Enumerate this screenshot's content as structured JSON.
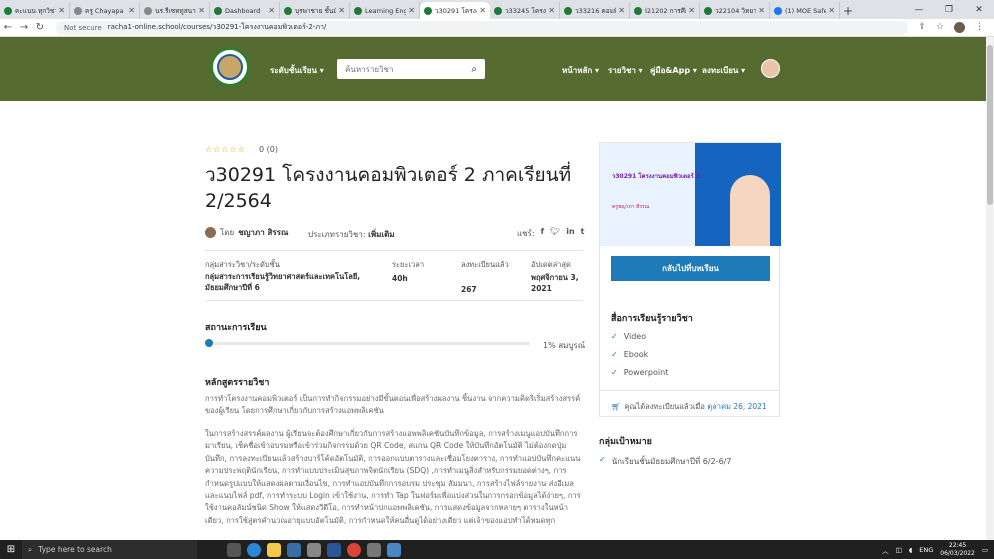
{
  "browser": {
    "tabs": [
      {
        "title": "คะแนน ทุกวิชา",
        "color": "#188038",
        "active": false
      },
      {
        "title": "ครู Chayapa",
        "color": "#888888",
        "active": false
      },
      {
        "title": "นร.รีเซททูสนาสรา",
        "color": "#888888",
        "active": false
      },
      {
        "title": "Dashboard",
        "color": "#1f7a3a",
        "active": false
      },
      {
        "title": "บุรพาชาย ชั้นมั",
        "color": "#1f7a3a",
        "active": false
      },
      {
        "title": "Learning Eng",
        "color": "#1f7a3a",
        "active": false
      },
      {
        "title": "ว30291 โครงง",
        "color": "#1f7a3a",
        "active": true
      },
      {
        "title": "ว33245 โครงง",
        "color": "#1f7a3a",
        "active": false
      },
      {
        "title": "ว33216 คอมพิ",
        "color": "#1f7a3a",
        "active": false
      },
      {
        "title": "I21202 การศึก",
        "color": "#1f7a3a",
        "active": false
      },
      {
        "title": "ว22104 วิทยาศ",
        "color": "#1f7a3a",
        "active": false
      },
      {
        "title": "(1) MOE Safe",
        "color": "#1877f2",
        "active": false
      }
    ],
    "new_tab": "+",
    "address": {
      "not_secure": "Not secure",
      "url": "racha1-online.school/courses/ว30291-โครงงานคอมพิวเตอร์-2-ภา/"
    }
  },
  "header": {
    "levels_label": "ระดับชั้นเรียน ▾",
    "search_placeholder": "ค้นหารายวิชา",
    "menu": [
      "หน้าหลัก ▾",
      "รายวิชา ▾",
      "คู่มือ&App ▾",
      "ลงทะเบียน ▾"
    ]
  },
  "course": {
    "stars": "☆☆☆☆☆",
    "rating": "0 (0)",
    "title": "ว30291 โครงงานคอมพิวเตอร์ 2 ภาคเรียนที่ 2/2564",
    "by_prefix": "โดย",
    "author": "ชญาภา สิรรณ",
    "category_prefix": "ประเภทรายวิชา:",
    "category": "เพิ่มเติม",
    "share_label": "แชร์:",
    "meta": {
      "group_label": "กลุ่มสาระวิชา/ระดับชั้น",
      "group_value": "กลุ่มสาระการเรียนรู้วิทยาศาสตร์และเทคโนโลยี, มัธยมศึกษาปีที่ 6",
      "duration_label": "ระยะเวลา",
      "duration_value": "40h",
      "enrolled_label": "ลงทะเบียนแล้ว",
      "enrolled_value": "267",
      "updated_label": "อัปเดตล่าสุด",
      "updated_value": "พฤศจิกายน 3, 2021"
    },
    "status_heading": "สถานะการเรียน",
    "progress_percent": 1,
    "progress_text": "1% สมบูรณ์",
    "curriculum_heading": "หลักสูตรรายวิชา",
    "para1": "การทำโครงงานคอมพิวเตอร์ เป็นการทำกิจกรรมอย่างมีขั้นตอนเพื่อสร้างผลงาน ชิ้นงาน จากความคิดริเริ่มสร้างสรรค์ของผู้เรียน โดยการศึกษาเกี่ยวกับการสร้างแอพพลิเคชัน",
    "para2": "ในการสร้างสรรค์ผลงาน ผู้เรียนจะต้องศึกษาเกี่ยวกับการสร้างแอพพลิเคชันบันทึกข้อมูล, การสร้างเมนูแอปบันทึกการมาเรียน, เช็คชื่อเข้าอบรมหรือเข้าร่วมกิจกรรมด้วย QR Code, สแกน QR Code ให้บันทึกอัตโนมัติ ไม่ต้องกดปุ่มบันทึก, การลงทะเบียนแล้วสร้างบาร์โค้ดอัตโนมัติ, การออกแบบตารางและเชื่อมโยงตาราง, การทำแอปบันทึกคะแนนความประพฤตินักเรียน, การทำแบบประเมินสุขภาพจิตนักเรียน (SDQ) ,การทำเมนูสิ่งสำหรับกรรมยอดต่างๆ, การกำหนดรูปแบบให้แสดงผลตามเงื่อนไข, การทำแอปบันทึกการอบรม ประชุม สัมมนา, การสร้างไฟล์รายงาน ส่งอีเมล และแนบไฟล์ pdf, การทำระบบ Login เข้าใช้งาน, การทำ Tap ในฟอร์มเพื่อแบ่งส่วนในการกรอกข้อมูลได้ง่ายๆ, การใช้งานคอลัมน์ชนิด Show ให้แสดงวีดีโอ, การทำหน้าปกแอพพลิเคชัน, การแสดงข้อมูลจากหลายๆ ตารางในหน้าเดียว, การใช้สูตรคำนวณอายุแบบอัตโนมัติ, การกำหนดให้คนอื่นดูได้อย่างเดียว แต่เจ้าของแอปทำได้หมดทุก"
  },
  "sidebar": {
    "thumb_title": "ว30291 โครงงานคอมพิวเตอร์ 2",
    "thumb_sub": "ครูชญาภา สิรรณ",
    "back_button": "กลับไปที่บทเรียน",
    "media_heading": "สื่อการเรียนรู้รายวิชา",
    "media": [
      "Video",
      "Ebook",
      "Powerpoint"
    ],
    "enrolled_prefix": "คุณได้ลงทะเบียนแล้วเมื่อ",
    "enrolled_date": "ตุลาคม 26, 2021",
    "target_heading": "กลุ่มเป้าหมาย",
    "target_item": "นักเรียนชั้นมัธยมศึกษาปีที่ 6/2-6/7"
  },
  "taskbar": {
    "search_placeholder": "Type here to search",
    "lang": "ENG",
    "time": "22:45",
    "date": "06/03/2022"
  },
  "colors": {
    "header_bg": "#556b2f",
    "accent": "#1f7ab8",
    "star": "#e0a500"
  }
}
